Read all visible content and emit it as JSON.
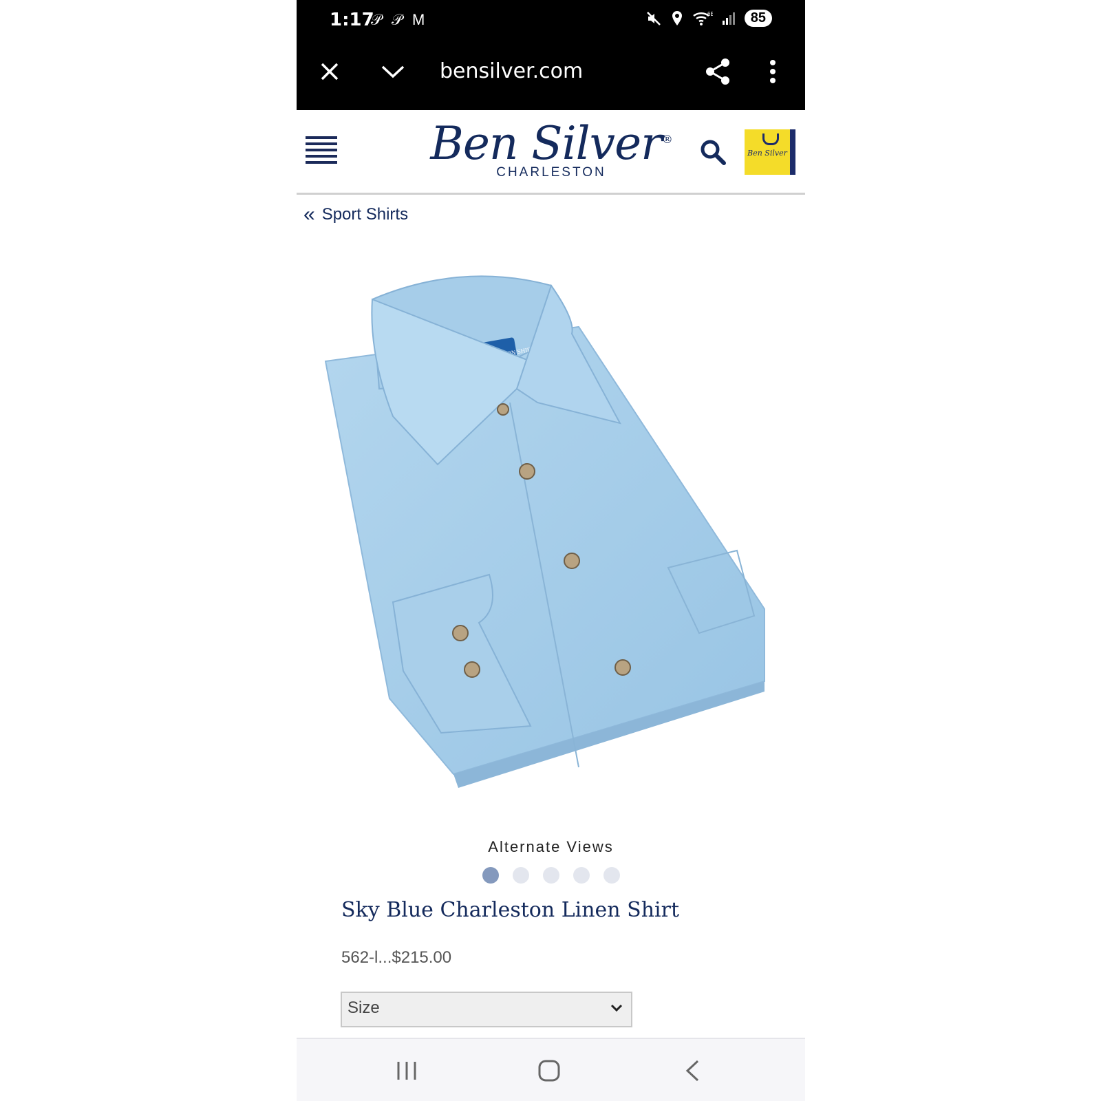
{
  "status_bar": {
    "time": "1:17",
    "app_icons": "𝒫 𝒫 M",
    "battery": "85"
  },
  "browser": {
    "url": "bensilver.com"
  },
  "site": {
    "logo_text": "Ben Silver",
    "logo_mark": "®",
    "logo_sub": "CHARLESTON",
    "cart_logo": "Ben Silver"
  },
  "breadcrumb": {
    "label": "Sport Shirts"
  },
  "gallery": {
    "label": "Alternate Views",
    "dots": 5,
    "active_index": 0
  },
  "product": {
    "title": "Sky Blue Charleston Linen Shirt",
    "sku_price": "562-l...$215.00"
  },
  "size_select": {
    "value": "Size"
  },
  "colors": {
    "brand_navy": "#142a5c",
    "shirt_blue": "#a9cfe9",
    "cart_yellow": "#f4dc29"
  }
}
